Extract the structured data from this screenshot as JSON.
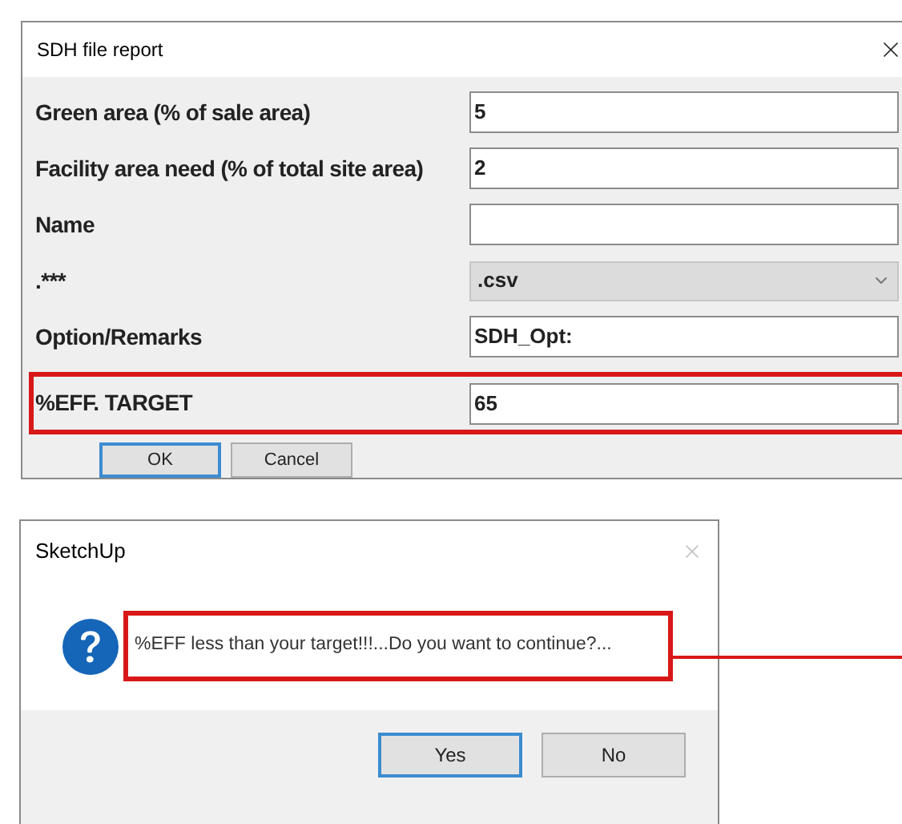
{
  "report_dialog": {
    "title": "SDH file report",
    "rows": [
      {
        "kind": "text",
        "label": "Green area (% of sale area)",
        "value": "5",
        "highlighted": false
      },
      {
        "kind": "text",
        "label": "Facility area need (% of total site area)",
        "value": "2",
        "highlighted": false
      },
      {
        "kind": "text",
        "label": "Name",
        "value": "",
        "highlighted": false
      },
      {
        "kind": "select",
        "label": ".***",
        "value": ".csv",
        "highlighted": false
      },
      {
        "kind": "text",
        "label": "Option/Remarks",
        "value": "SDH_Opt:",
        "highlighted": false
      },
      {
        "kind": "text",
        "label": "%EFF. TARGET",
        "value": "65",
        "highlighted": true
      }
    ],
    "buttons": [
      {
        "label": "OK",
        "default": true
      },
      {
        "label": "Cancel",
        "default": false
      }
    ]
  },
  "message_dialog": {
    "title": "SketchUp",
    "message": "%EFF less than your target!!!...Do you want to continue?...",
    "highlighted": true,
    "buttons": [
      {
        "label": "Yes",
        "default": true
      },
      {
        "label": "No",
        "default": false
      }
    ]
  }
}
